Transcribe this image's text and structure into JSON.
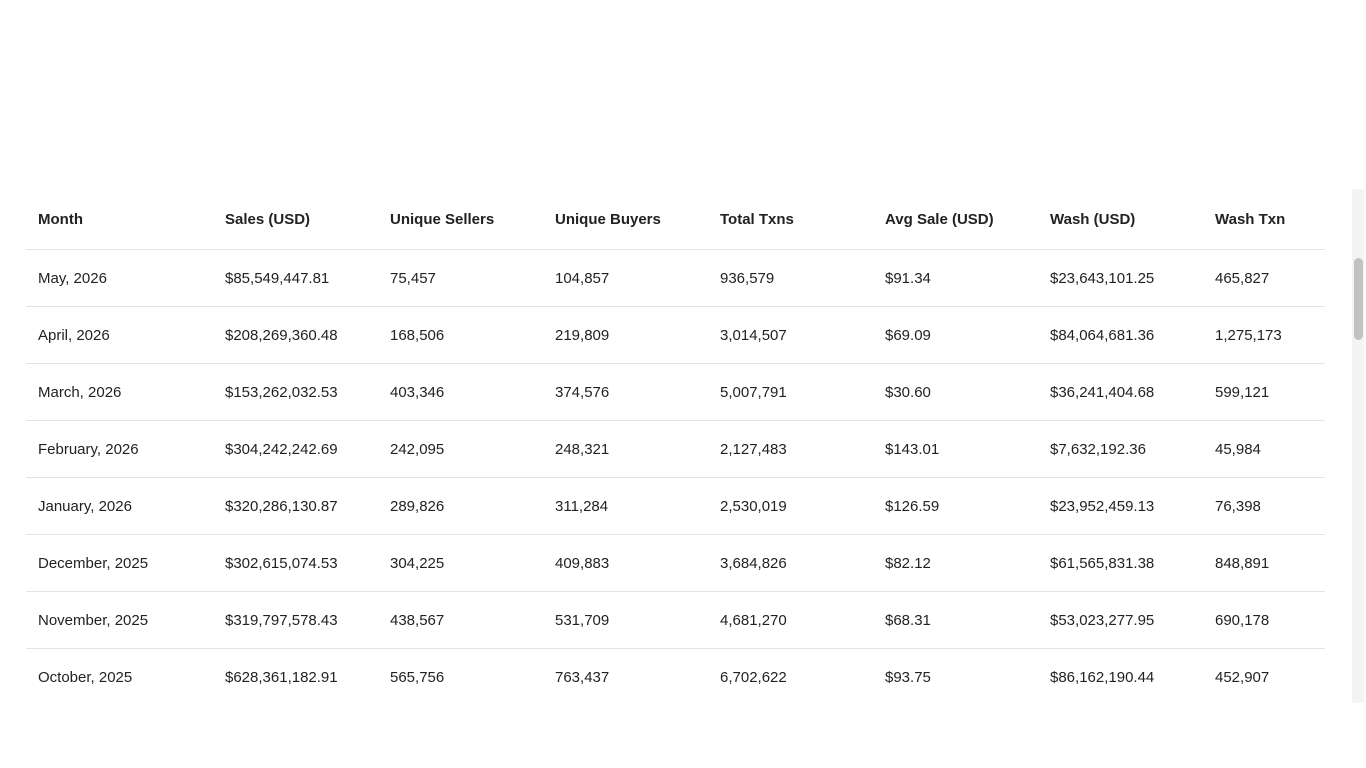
{
  "table": {
    "columns": [
      "Month",
      "Sales (USD)",
      "Unique Sellers",
      "Unique Buyers",
      "Total Txns",
      "Avg Sale (USD)",
      "Wash (USD)",
      "Wash Txn"
    ],
    "rows": [
      [
        "May, 2026",
        "$85,549,447.81",
        "75,457",
        "104,857",
        "936,579",
        "$91.34",
        "$23,643,101.25",
        "465,827"
      ],
      [
        "April, 2026",
        "$208,269,360.48",
        "168,506",
        "219,809",
        "3,014,507",
        "$69.09",
        "$84,064,681.36",
        "1,275,173"
      ],
      [
        "March, 2026",
        "$153,262,032.53",
        "403,346",
        "374,576",
        "5,007,791",
        "$30.60",
        "$36,241,404.68",
        "599,121"
      ],
      [
        "February, 2026",
        "$304,242,242.69",
        "242,095",
        "248,321",
        "2,127,483",
        "$143.01",
        "$7,632,192.36",
        "45,984"
      ],
      [
        "January, 2026",
        "$320,286,130.87",
        "289,826",
        "311,284",
        "2,530,019",
        "$126.59",
        "$23,952,459.13",
        "76,398"
      ],
      [
        "December, 2025",
        "$302,615,074.53",
        "304,225",
        "409,883",
        "3,684,826",
        "$82.12",
        "$61,565,831.38",
        "848,891"
      ],
      [
        "November, 2025",
        "$319,797,578.43",
        "438,567",
        "531,709",
        "4,681,270",
        "$68.31",
        "$53,023,277.95",
        "690,178"
      ],
      [
        "October, 2025",
        "$628,361,182.91",
        "565,756",
        "763,437",
        "6,702,622",
        "$93.75",
        "$86,162,190.44",
        "452,907"
      ]
    ]
  }
}
